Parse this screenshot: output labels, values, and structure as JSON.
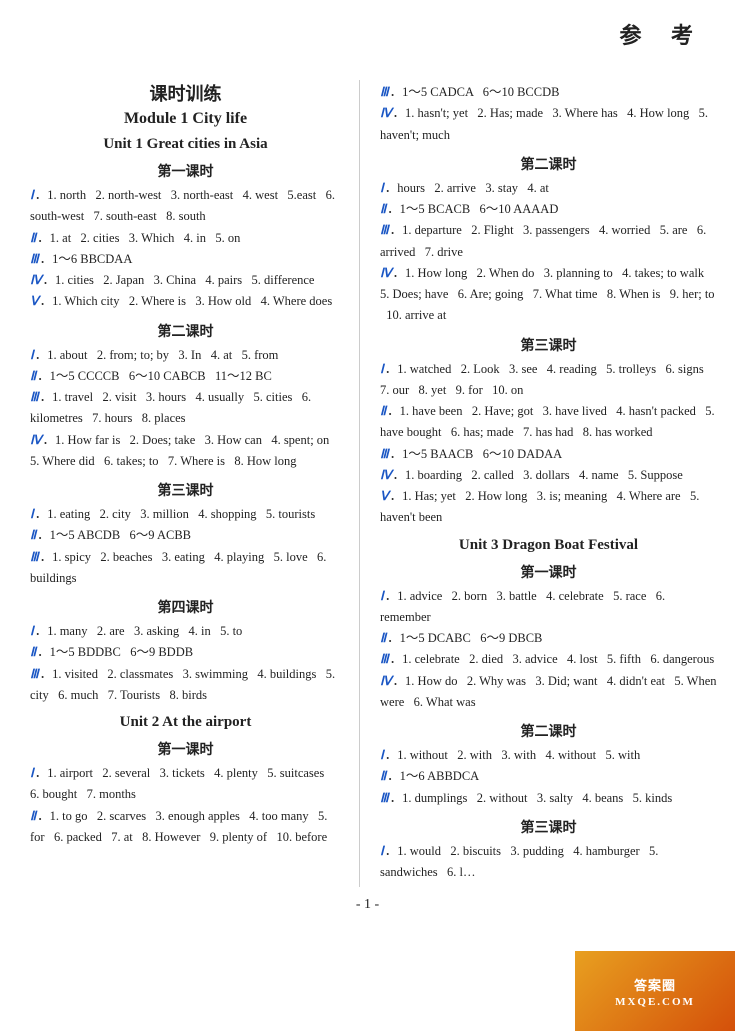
{
  "topRight": "参  考",
  "leftCol": {
    "mainTitle": "课时训练",
    "moduleTitle": "Module 1    City life",
    "unit1Title": "Unit 1   Great cities in Asia",
    "lessons": [
      {
        "title": "第一课时",
        "lines": [
          {
            "label": "Ⅰ",
            "text": "．1. north   2. north-west   3. north-east   4. west   5.east   6. south-west   7. south-east   8. south"
          },
          {
            "label": "Ⅱ",
            "text": "．1. at   2. cities   3. Which   4. in   5. on"
          },
          {
            "label": "Ⅲ",
            "text": "．1～6 BBCDAA"
          },
          {
            "label": "Ⅳ",
            "text": "．1. cities   2. Japan   3. China   4. pairs   5. difference"
          },
          {
            "label": "Ⅴ",
            "text": "．1. Which city   2. Where is   3. How old   4. Where does"
          }
        ]
      },
      {
        "title": "第二课时",
        "lines": [
          {
            "label": "Ⅰ",
            "text": "．1. about   2. from; to; by   3. In   4. at   5. from"
          },
          {
            "label": "Ⅱ",
            "text": "．1～5 CCCCB   6～10 CABCB   11～12 BC"
          },
          {
            "label": "Ⅲ",
            "text": "．1. travel   2. visit   3. hours   4. usually   5. cities   6. kilometres   7. hours   8. places"
          },
          {
            "label": "Ⅳ",
            "text": "．1. How far is   2. Does; take   3. How can   4. spent; on   5. Where did   6. takes; to   7. Where is   8. How long"
          }
        ]
      },
      {
        "title": "第三课时",
        "lines": [
          {
            "label": "Ⅰ",
            "text": "．1. eating   2. city   3. million   4. shopping   5. tourists"
          },
          {
            "label": "Ⅱ",
            "text": "．1～5 ABCDB   6～9 ACBB"
          },
          {
            "label": "Ⅲ",
            "text": "．1. spicy   2. beaches   3. eating   4. playing   5. love   6. buildings"
          }
        ]
      },
      {
        "title": "第四课时",
        "lines": [
          {
            "label": "Ⅰ",
            "text": "．1. many   2. are   3. asking   4. in   5. to"
          },
          {
            "label": "Ⅱ",
            "text": "．1～5 BDDBC   6～9 BDDB"
          },
          {
            "label": "Ⅲ",
            "text": "．1. visited   2. classmates   3. swimming   4. buildings   5. city   6. much   7. Tourists   8. birds"
          }
        ]
      }
    ],
    "unit2Title": "Unit 2   At the airport",
    "unit2Lessons": [
      {
        "title": "第一课时",
        "lines": [
          {
            "label": "Ⅰ",
            "text": "．1. airport   2. several   3. tickets   4. plenty   5. suitcases   6. bought   7. months"
          },
          {
            "label": "Ⅱ",
            "text": "．1. to go   2. scarves   3. enough apples   4. too many   5. for   6. packed   7. at   8. However   9. plenty of   10. before"
          }
        ]
      }
    ]
  },
  "rightCol": {
    "unit1RightLines": [
      {
        "label": "Ⅲ",
        "text": "．1～5 CADCA   6～10 BCCDB"
      },
      {
        "label": "Ⅳ",
        "text": "．1. hasn't; yet   2. Has; made   3. Where has   4. How long   5. haven't; much"
      }
    ],
    "unit1Lesson2Right": {
      "title": "第二课时",
      "lines": [
        {
          "label": "Ⅰ",
          "text": "．hours   2. arrive   3. stay   4. at"
        },
        {
          "label": "Ⅱ",
          "text": "．1～5 BCACB   6～10 AAAAD"
        },
        {
          "label": "Ⅲ",
          "text": "．1. departure   2. Flight   3. passengers   4. worried   5. are   6. arrived   7. drive"
        },
        {
          "label": "Ⅳ",
          "text": "．1. How long   2. When do   3. planning to   4. takes; to walk   5. Does; have   6. Are; going   7. What time   8. When is   9. her; to   10. arrive at"
        }
      ]
    },
    "unit1Lesson3Right": {
      "title": "第三课时",
      "lines": [
        {
          "label": "Ⅰ",
          "text": "．1. watched   2. Look   3. see   4. reading   5. trolleys   6. signs   7. our   8. yet   9. for   10. on"
        },
        {
          "label": "Ⅱ",
          "text": "．1. have been   2. Have; got   3. have lived   4. hasn't packed   5. have bought   6. has; made   7. has had   8. has worked"
        },
        {
          "label": "Ⅲ",
          "text": "．1～5 BAACB   6～10 DADAA"
        },
        {
          "label": "Ⅳ",
          "text": "．1. boarding   2. called   3. dollars   4. name   5. Suppose"
        },
        {
          "label": "Ⅴ",
          "text": "．1. Has; yet   2. How long   3. is; meaning   4. Where are   5. haven't been"
        }
      ]
    },
    "unit3Title": "Unit 3   Dragon Boat Festival",
    "unit3Lessons": [
      {
        "title": "第一课时",
        "lines": [
          {
            "label": "Ⅰ",
            "text": "．1. advice   2. born   3. battle   4. celebrate   5. race   6. remember"
          },
          {
            "label": "Ⅱ",
            "text": "．1～5 DCABC   6～9 DBCB"
          },
          {
            "label": "Ⅲ",
            "text": "．1. celebrate   2. died   3. advice   4. lost   5. fifth   6. dangerous"
          },
          {
            "label": "Ⅳ",
            "text": "．1. How do   2. Why was   3. Did; want   4. didn't eat   5. When were   6. What was"
          }
        ]
      },
      {
        "title": "第二课时",
        "lines": [
          {
            "label": "Ⅰ",
            "text": "．1. without   2. with   3. with   4. without   5. with"
          },
          {
            "label": "Ⅱ",
            "text": "．1～6 ABBDCA"
          },
          {
            "label": "Ⅲ",
            "text": "．1. dumplings   2. without   3. salty   4. beans   5. kinds"
          }
        ]
      },
      {
        "title": "第三课时",
        "lines": [
          {
            "label": "Ⅰ",
            "text": "．1. would   2. biscuits   3. pudding   4. hamburger   5. sandwiches   6. l…"
          }
        ]
      }
    ]
  },
  "pageNumber": "- 1 -",
  "watermark": {
    "icon": "🏠",
    "text": "MXQ E.COM"
  }
}
